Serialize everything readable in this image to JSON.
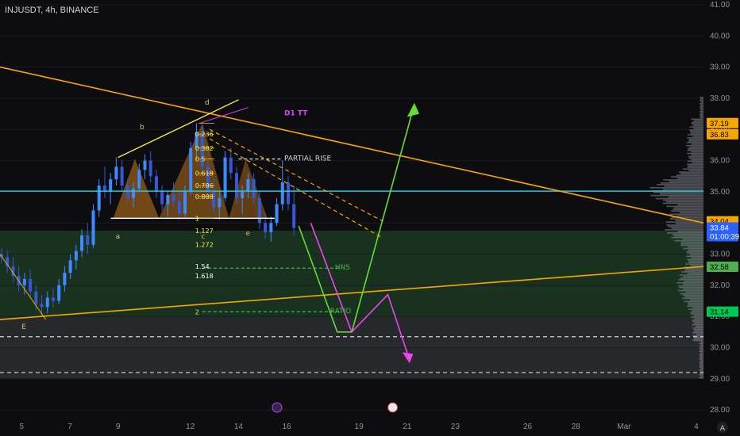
{
  "header": {
    "symbol_line": "INJUSDT, 4h, BINANCE"
  },
  "chart_data": {
    "type": "candlestick",
    "y_axis": {
      "ticks": [
        "41.00",
        "40.00",
        "39.00",
        "38.00",
        "37.00",
        "36.00",
        "35.00",
        "34.00",
        "33.00",
        "32.00",
        "31.00",
        "30.00",
        "29.00",
        "28.00"
      ],
      "ylim": [
        27.8,
        41.1
      ]
    },
    "x_axis": {
      "ticks": [
        {
          "label": "5",
          "x": 5
        },
        {
          "label": "7",
          "x": 7
        },
        {
          "label": "9",
          "x": 9
        },
        {
          "label": "12",
          "x": 12
        },
        {
          "label": "14",
          "x": 14
        },
        {
          "label": "16",
          "x": 16
        },
        {
          "label": "19",
          "x": 19
        },
        {
          "label": "21",
          "x": 21
        },
        {
          "label": "23",
          "x": 23
        },
        {
          "label": "26",
          "x": 26
        },
        {
          "label": "28",
          "x": 28
        },
        {
          "label": "Mar",
          "x": 30
        },
        {
          "label": "4",
          "x": 33
        }
      ],
      "xlim": [
        4.1,
        33.3
      ]
    },
    "price_tags": [
      {
        "value": 37.19,
        "label": "37.19",
        "color": "#f7a600",
        "text": "#000000"
      },
      {
        "value": 36.83,
        "label": "36.83",
        "color": "#f7a600",
        "text": "#000000"
      },
      {
        "value": 34.04,
        "label": "34.04",
        "color": "#f7a600",
        "text": "#000000"
      },
      {
        "value": 33.84,
        "label": "33.84",
        "label2": "01:00:39",
        "color": "#2962ff",
        "text": "#ffffff"
      },
      {
        "value": 32.58,
        "label": "32.58",
        "color": "#4caf50",
        "text": "#000000"
      },
      {
        "value": 31.14,
        "label": "31.14",
        "color": "#00c853",
        "text": "#000000"
      }
    ],
    "annotations": [
      {
        "text": "D1 TT",
        "color": "#e040fb"
      },
      {
        "text": "PARTIAL RISE",
        "color": "#d1d4dc"
      },
      {
        "text": "HNS",
        "color": "#4caf50"
      },
      {
        "text": "RATIO",
        "color": "#4caf50"
      }
    ],
    "wave_labels": [
      "a",
      "b",
      "c",
      "d",
      "e",
      "E"
    ],
    "fib_levels": [
      "0.236",
      "0.382",
      "0.5",
      "0.618",
      "0.786",
      "0.888",
      "1",
      "1.127",
      "1.272",
      "1.54",
      "1.618",
      "2"
    ],
    "candles": [
      {
        "o": 33.0,
        "h": 33.2,
        "l": 32.7,
        "c": 32.9
      },
      {
        "o": 32.9,
        "h": 33.1,
        "l": 32.4,
        "c": 32.6
      },
      {
        "o": 32.6,
        "h": 32.9,
        "l": 32.1,
        "c": 32.3
      },
      {
        "o": 32.3,
        "h": 32.6,
        "l": 31.8,
        "c": 32.0
      },
      {
        "o": 32.0,
        "h": 32.4,
        "l": 31.7,
        "c": 32.2
      },
      {
        "o": 32.2,
        "h": 32.5,
        "l": 31.6,
        "c": 31.8
      },
      {
        "o": 31.8,
        "h": 32.0,
        "l": 31.2,
        "c": 31.4
      },
      {
        "o": 31.4,
        "h": 31.7,
        "l": 31.0,
        "c": 31.3
      },
      {
        "o": 31.3,
        "h": 31.8,
        "l": 31.1,
        "c": 31.6
      },
      {
        "o": 31.6,
        "h": 31.9,
        "l": 31.3,
        "c": 31.5
      },
      {
        "o": 31.5,
        "h": 32.2,
        "l": 31.4,
        "c": 32.0
      },
      {
        "o": 32.0,
        "h": 32.6,
        "l": 31.8,
        "c": 32.4
      },
      {
        "o": 32.4,
        "h": 33.0,
        "l": 32.2,
        "c": 32.8
      },
      {
        "o": 32.8,
        "h": 33.3,
        "l": 32.5,
        "c": 33.1
      },
      {
        "o": 33.1,
        "h": 33.8,
        "l": 32.9,
        "c": 33.6
      },
      {
        "o": 33.6,
        "h": 34.0,
        "l": 33.0,
        "c": 33.3
      },
      {
        "o": 33.3,
        "h": 34.6,
        "l": 33.2,
        "c": 34.4
      },
      {
        "o": 34.4,
        "h": 35.4,
        "l": 34.2,
        "c": 35.2
      },
      {
        "o": 35.2,
        "h": 35.8,
        "l": 34.8,
        "c": 35.0
      },
      {
        "o": 35.0,
        "h": 35.6,
        "l": 34.6,
        "c": 35.4
      },
      {
        "o": 35.4,
        "h": 36.1,
        "l": 35.2,
        "c": 35.8
      },
      {
        "o": 35.8,
        "h": 36.0,
        "l": 35.0,
        "c": 35.2
      },
      {
        "o": 35.2,
        "h": 35.4,
        "l": 34.6,
        "c": 34.8
      },
      {
        "o": 34.8,
        "h": 35.3,
        "l": 34.5,
        "c": 35.1
      },
      {
        "o": 35.1,
        "h": 35.9,
        "l": 35.0,
        "c": 35.7
      },
      {
        "o": 35.7,
        "h": 36.2,
        "l": 35.4,
        "c": 36.0
      },
      {
        "o": 36.0,
        "h": 36.3,
        "l": 35.3,
        "c": 35.5
      },
      {
        "o": 35.5,
        "h": 35.7,
        "l": 34.8,
        "c": 35.0
      },
      {
        "o": 35.0,
        "h": 35.2,
        "l": 34.4,
        "c": 34.6
      },
      {
        "o": 34.6,
        "h": 35.0,
        "l": 34.2,
        "c": 34.9
      },
      {
        "o": 34.9,
        "h": 35.3,
        "l": 34.5,
        "c": 34.7
      },
      {
        "o": 34.7,
        "h": 35.0,
        "l": 34.1,
        "c": 34.3
      },
      {
        "o": 34.3,
        "h": 35.2,
        "l": 34.2,
        "c": 35.0
      },
      {
        "o": 35.0,
        "h": 36.6,
        "l": 34.9,
        "c": 36.4
      },
      {
        "o": 36.4,
        "h": 37.2,
        "l": 36.0,
        "c": 36.9
      },
      {
        "o": 36.9,
        "h": 37.1,
        "l": 35.6,
        "c": 35.8
      },
      {
        "o": 35.8,
        "h": 36.0,
        "l": 34.8,
        "c": 35.0
      },
      {
        "o": 35.0,
        "h": 35.4,
        "l": 34.3,
        "c": 34.5
      },
      {
        "o": 34.5,
        "h": 35.0,
        "l": 34.1,
        "c": 34.8
      },
      {
        "o": 34.8,
        "h": 36.3,
        "l": 34.7,
        "c": 36.1
      },
      {
        "o": 36.1,
        "h": 36.4,
        "l": 35.4,
        "c": 35.6
      },
      {
        "o": 35.6,
        "h": 35.8,
        "l": 34.6,
        "c": 34.8
      },
      {
        "o": 34.8,
        "h": 35.2,
        "l": 34.3,
        "c": 35.0
      },
      {
        "o": 35.0,
        "h": 35.6,
        "l": 34.8,
        "c": 35.4
      },
      {
        "o": 35.4,
        "h": 35.6,
        "l": 34.6,
        "c": 34.8
      },
      {
        "o": 34.8,
        "h": 35.0,
        "l": 33.8,
        "c": 34.0
      },
      {
        "o": 34.0,
        "h": 34.3,
        "l": 33.5,
        "c": 33.7
      },
      {
        "o": 33.7,
        "h": 34.2,
        "l": 33.4,
        "c": 34.0
      },
      {
        "o": 34.0,
        "h": 34.8,
        "l": 33.9,
        "c": 34.6
      },
      {
        "o": 34.6,
        "h": 36.0,
        "l": 34.4,
        "c": 35.3
      },
      {
        "o": 35.3,
        "h": 35.5,
        "l": 34.4,
        "c": 34.6
      },
      {
        "o": 34.6,
        "h": 35.2,
        "l": 33.6,
        "c": 33.84
      }
    ],
    "colors": {
      "up": "#3d8bff",
      "down": "#3658d6",
      "bg": "#0d0d0f",
      "orange": "#f7a600",
      "green": "#4caf50",
      "magenta": "#e040fb",
      "teal": "#26c6da",
      "yellow": "#ffeb3b"
    }
  }
}
